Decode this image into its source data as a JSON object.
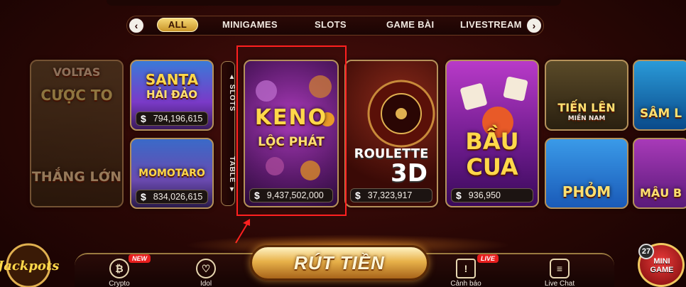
{
  "tabs": {
    "prev_icon": "chevron-left-icon",
    "next_icon": "chevron-right-icon",
    "items": [
      "ALL",
      "MINIGAMES",
      "SLOTS",
      "GAME BÀI",
      "LIVESTREAM"
    ],
    "selected": "ALL"
  },
  "side_tabs": {
    "slots": "▲ SLOTS",
    "table": "TABLE ▼"
  },
  "games": [
    {
      "id": "voltas",
      "title": "VOLTAS\nCƯỢC TO\nTHẮNG LỚN",
      "jackpot": ""
    },
    {
      "id": "santa",
      "title": "SANTA\nHẢI ĐẢO",
      "jackpot": "794,196,615"
    },
    {
      "id": "momotaro",
      "title": "MOMOTARO",
      "jackpot": "834,026,615"
    },
    {
      "id": "keno",
      "title": "KENO\nLỘC PHÁT",
      "jackpot": "9,437,502,000"
    },
    {
      "id": "roulette",
      "title": "ROULETTE\n3D",
      "jackpot": "37,323,917"
    },
    {
      "id": "baucua",
      "title": "BẦU\nCUA",
      "jackpot": "936,950"
    },
    {
      "id": "tienlen",
      "title": "TIẾN LÊN\nMIỀN NAM",
      "jackpot": ""
    },
    {
      "id": "samloc",
      "title": "SÂM L",
      "jackpot": ""
    },
    {
      "id": "phom",
      "title": "PHỎM",
      "jackpot": ""
    },
    {
      "id": "maubinh",
      "title": "MẬU B",
      "jackpot": ""
    }
  ],
  "card_labels": {
    "voltas_1": "VOLTAS",
    "voltas_2": "CƯỢC TO",
    "voltas_3": "THẮNG LỚN",
    "santa_1": "SANTA",
    "santa_2": "HẢI ĐẢO",
    "momotaro": "MOMOTARO",
    "keno_1": "KENO",
    "keno_2": "LỘC PHÁT",
    "roulette_1": "ROULETTE",
    "roulette_2": "3D",
    "baucua_1": "BẦU",
    "baucua_2": "CUA",
    "tienlen_1": "TIẾN LÊN",
    "tienlen_2": "MIỀN NAM",
    "samloc": "SÂM L",
    "phom": "PHỎM",
    "maubinh": "MẬU B"
  },
  "currency_symbol": "$",
  "jackpots": {
    "santa": "794,196,615",
    "momotaro": "834,026,615",
    "keno": "9,437,502,000",
    "roulette": "37,323,917",
    "baucua": "936,950"
  },
  "bottom_nav": {
    "crypto": {
      "label": "Crypto",
      "badge": "NEW",
      "icon": "bitcoin-icon"
    },
    "idol": {
      "label": "Idol",
      "icon": "heart-icon"
    },
    "withdraw": "RÚT TIỀN",
    "canh_bao": {
      "label": "Cảnh báo",
      "badge": "LIVE",
      "icon": "warning-icon"
    },
    "live_chat": {
      "label": "Live Chat",
      "icon": "chat-icon"
    }
  },
  "jackpots_logo": "Jackpots",
  "mini_game": {
    "label": "MINI GAME",
    "count": "27"
  },
  "colors": {
    "accent_gold": "#e8b24a",
    "highlight_red": "#ff2020",
    "background": "#2a0705"
  }
}
